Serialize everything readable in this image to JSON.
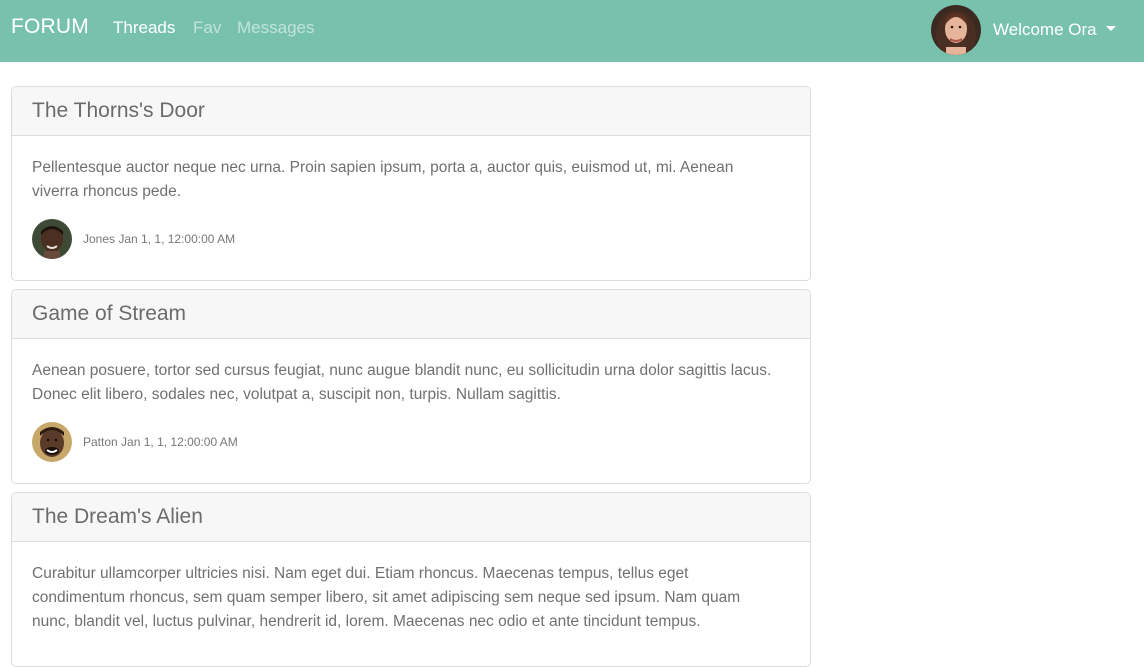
{
  "navbar": {
    "brand": "FORUM",
    "links": [
      "Threads",
      "Fav",
      "Messages"
    ],
    "user": {
      "welcome": "Welcome Ora",
      "avatar_icon": "user-avatar-photo"
    },
    "background_color": "#78c2ad"
  },
  "threads": [
    {
      "title": "The Thorns's Door",
      "body": "Pellentesque auctor neque nec urna. Proin sapien ipsum, porta a, auctor quis, euismod ut, mi. Aenean viverra rhoncus pede.",
      "author": "Jones",
      "date": "Jan 1, 1, 12:00:00 AM"
    },
    {
      "title": "Game of Stream",
      "body": "Aenean posuere, tortor sed cursus feugiat, nunc augue blandit nunc, eu sollicitudin urna dolor sagittis lacus. Donec elit libero, sodales nec, volutpat a, suscipit non, turpis. Nullam sagittis.",
      "author": "Patton",
      "date": "Jan 1, 1, 12:00:00 AM"
    },
    {
      "title": "The Dream's Alien",
      "body": "Curabitur ullamcorper ultricies nisi. Nam eget dui. Etiam rhoncus. Maecenas tempus, tellus eget condimentum rhoncus, sem quam semper libero, sit amet adipiscing sem neque sed ipsum. Nam quam nunc, blandit vel, luctus pulvinar, hendrerit id, lorem. Maecenas nec odio et ante tincidunt tempus."
    }
  ]
}
